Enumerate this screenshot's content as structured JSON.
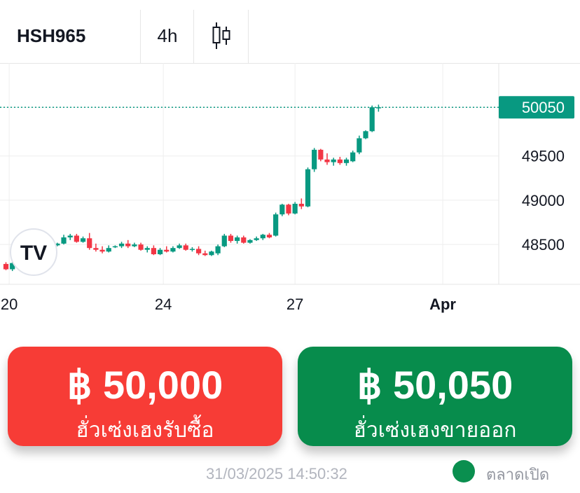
{
  "toolbar": {
    "symbol": "HSH965",
    "interval": "4h",
    "chart_type_icon": "candlestick-icon"
  },
  "chart_data": {
    "type": "candlestick",
    "title": "",
    "y_ticks": [
      48500,
      49000,
      49500
    ],
    "ylim": [
      48050,
      50550
    ],
    "x_ticks": [
      {
        "label": "20",
        "index": 0.5
      },
      {
        "label": "24",
        "index": 24.5
      },
      {
        "label": "27",
        "index": 45
      },
      {
        "label": "Apr",
        "index": 68
      }
    ],
    "last_price_label": "50050",
    "last_price": 50050,
    "logo": "TV",
    "candles": [
      [
        48280,
        48300,
        48210,
        48220
      ],
      [
        48220,
        48300,
        48200,
        48290
      ],
      [
        48280,
        48320,
        48270,
        48300
      ],
      [
        48300,
        48380,
        48280,
        48360
      ],
      [
        48360,
        48380,
        48340,
        48370
      ],
      [
        48370,
        48550,
        48350,
        48530
      ],
      [
        48530,
        48550,
        48480,
        48500
      ],
      [
        48500,
        48510,
        48470,
        48490
      ],
      [
        48490,
        48520,
        48480,
        48510
      ],
      [
        48510,
        48610,
        48500,
        48580
      ],
      [
        48580,
        48620,
        48550,
        48600
      ],
      [
        48600,
        48620,
        48520,
        48530
      ],
      [
        48530,
        48590,
        48520,
        48570
      ],
      [
        48570,
        48630,
        48440,
        48460
      ],
      [
        48460,
        48510,
        48420,
        48440
      ],
      [
        48440,
        48480,
        48400,
        48420
      ],
      [
        48420,
        48490,
        48410,
        48460
      ],
      [
        48470,
        48490,
        48460,
        48480
      ],
      [
        48480,
        48530,
        48460,
        48510
      ],
      [
        48510,
        48550,
        48460,
        48480
      ],
      [
        48480,
        48520,
        48470,
        48500
      ],
      [
        48500,
        48520,
        48430,
        48440
      ],
      [
        48440,
        48480,
        48410,
        48460
      ],
      [
        48460,
        48490,
        48380,
        48390
      ],
      [
        48390,
        48460,
        48380,
        48440
      ],
      [
        48440,
        48480,
        48410,
        48420
      ],
      [
        48420,
        48480,
        48410,
        48460
      ],
      [
        48460,
        48510,
        48450,
        48490
      ],
      [
        48490,
        48510,
        48430,
        48440
      ],
      [
        48440,
        48470,
        48420,
        48450
      ],
      [
        48450,
        48480,
        48380,
        48400
      ],
      [
        48400,
        48430,
        48370,
        48380
      ],
      [
        48380,
        48430,
        48370,
        48420
      ],
      [
        48400,
        48500,
        48380,
        48480
      ],
      [
        48480,
        48620,
        48470,
        48600
      ],
      [
        48600,
        48620,
        48520,
        48540
      ],
      [
        48540,
        48600,
        48510,
        48580
      ],
      [
        48580,
        48600,
        48510,
        48520
      ],
      [
        48520,
        48560,
        48510,
        48550
      ],
      [
        48550,
        48590,
        48540,
        48570
      ],
      [
        48570,
        48620,
        48550,
        48610
      ],
      [
        48610,
        48630,
        48570,
        48580
      ],
      [
        48600,
        48860,
        48590,
        48840
      ],
      [
        48840,
        48960,
        48820,
        48950
      ],
      [
        48950,
        48960,
        48830,
        48850
      ],
      [
        48850,
        48980,
        48840,
        48960
      ],
      [
        48960,
        49020,
        48900,
        48930
      ],
      [
        48930,
        49370,
        48920,
        49350
      ],
      [
        49350,
        49590,
        49320,
        49570
      ],
      [
        49570,
        49580,
        49440,
        49460
      ],
      [
        49460,
        49530,
        49400,
        49430
      ],
      [
        49430,
        49480,
        49390,
        49460
      ],
      [
        49460,
        49490,
        49400,
        49420
      ],
      [
        49420,
        49480,
        49390,
        49460
      ],
      [
        49440,
        49560,
        49430,
        49540
      ],
      [
        49540,
        49730,
        49520,
        49700
      ],
      [
        49700,
        49790,
        49690,
        49780
      ],
      [
        49780,
        50070,
        49770,
        50050
      ],
      [
        50050,
        50080,
        50000,
        50050
      ]
    ]
  },
  "buy": {
    "price": "฿ 50,000",
    "label": "ฮั่วเซ่งเฮงรับซื้อ"
  },
  "sell": {
    "price": "฿ 50,050",
    "label": "ฮั่วเซ่งเฮงขายออก"
  },
  "footer": {
    "timestamp": "31/03/2025 14:50:32",
    "market_status": "ตลาดเปิด"
  },
  "colors": {
    "up": "#089981",
    "down": "#f23645",
    "grid": "#eeeeee",
    "price_line": "#089981",
    "market_dot": "#0a8f4f"
  }
}
